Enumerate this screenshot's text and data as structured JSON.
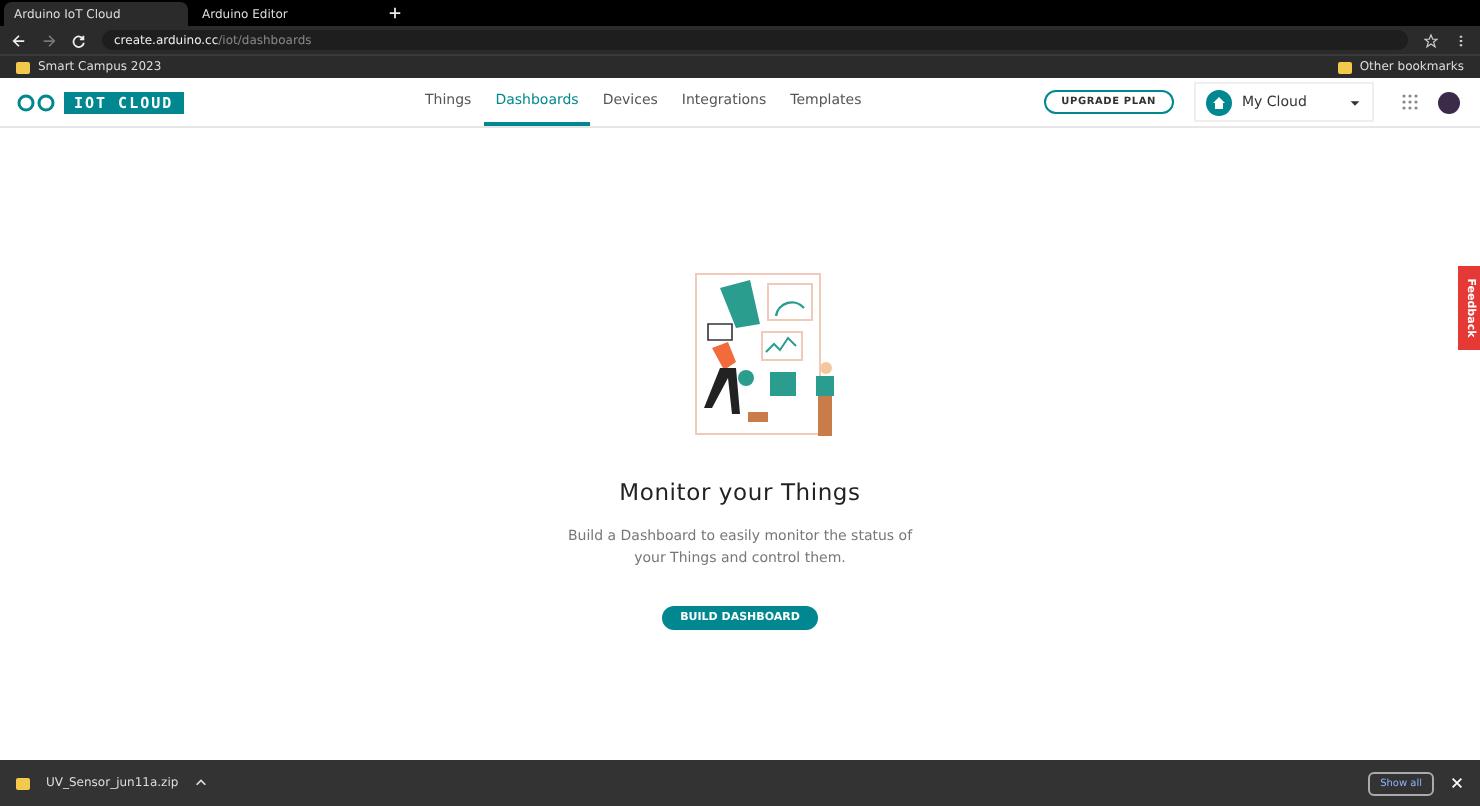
{
  "browser": {
    "tabs": [
      {
        "title": "Arduino IoT Cloud",
        "selected": true
      },
      {
        "title": "Arduino Editor",
        "selected": false
      }
    ],
    "url_host": "create.arduino.cc",
    "url_path": "/iot/dashboards",
    "bookmarks": [
      "Smart Campus 2023"
    ],
    "other_bookmarks": "Other bookmarks"
  },
  "header": {
    "logo": "IOT CLOUD",
    "nav": [
      {
        "label": "Things",
        "selected": false
      },
      {
        "label": "Dashboards",
        "selected": true
      },
      {
        "label": "Devices",
        "selected": false
      },
      {
        "label": "Integrations",
        "selected": false
      },
      {
        "label": "Templates",
        "selected": false
      }
    ],
    "upgrade": "UPGRADE PLAN",
    "space": "My Cloud"
  },
  "empty_state": {
    "title": "Monitor your Things",
    "text": "Build a Dashboard to easily monitor the status of your Things and control them.",
    "button": "BUILD DASHBOARD"
  },
  "feedback": "Feedback",
  "downloads": {
    "file": "UV_Sensor_jun11a.zip",
    "show_all": "Show all"
  }
}
